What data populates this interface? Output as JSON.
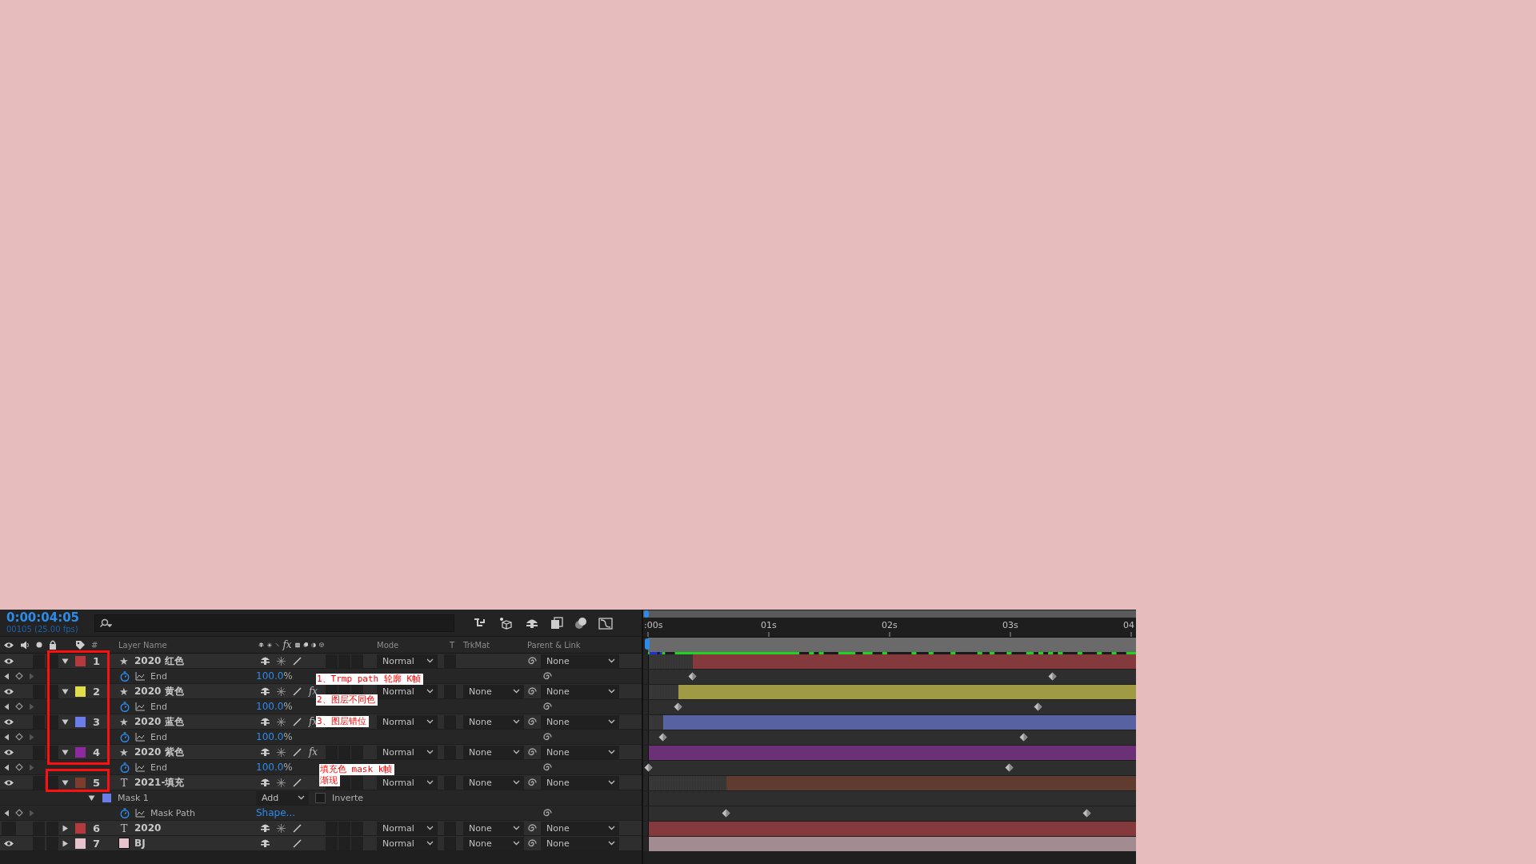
{
  "time": {
    "timecode": "0:00:04:05",
    "frames": "00105 (25.00 fps)"
  },
  "columns": {
    "hash": "#",
    "layer_name": "Layer Name",
    "effects": "fx",
    "mode": "Mode",
    "t": "T",
    "trkmat": "TrkMat",
    "parent": "Parent & Link"
  },
  "ruler": [
    ":00s",
    "01s",
    "02s",
    "03s",
    "04"
  ],
  "rows": [
    {
      "kind": "layer",
      "number": "1",
      "icon": "★",
      "name": "2020 红色",
      "color": "#b53a3e",
      "expanded": true,
      "visible": true,
      "mode": "Normal",
      "parent": "None",
      "level": 0.91
    },
    {
      "kind": "property",
      "name": "End",
      "value": "100.0",
      "unit": "%"
    },
    {
      "kind": "layer",
      "number": "2",
      "icon": "★",
      "name": "2020 黄色",
      "color": "#e3dc4a",
      "expanded": true,
      "visible": true,
      "effects": "fx",
      "mode": "Normal",
      "trkmat": "None",
      "parent": "None",
      "level": 0.94
    },
    {
      "kind": "property",
      "name": "End",
      "value": "100.0",
      "unit": "%"
    },
    {
      "kind": "layer",
      "number": "3",
      "icon": "★",
      "name": "2020 蓝色",
      "color": "#6b7de8",
      "expanded": true,
      "visible": true,
      "effects": "fx",
      "mode": "Normal",
      "trkmat": "None",
      "parent": "None",
      "level": 0.97
    },
    {
      "kind": "property",
      "name": "End",
      "value": "100.0",
      "unit": "%"
    },
    {
      "kind": "layer",
      "number": "4",
      "icon": "★",
      "name": "2020 紫色",
      "color": "#8e2aa0",
      "expanded": true,
      "visible": true,
      "effects": "fx",
      "mode": "Normal",
      "trkmat": "None",
      "parent": "None",
      "level": 1
    },
    {
      "kind": "property",
      "name": "End",
      "value": "100.0",
      "unit": "%"
    },
    {
      "kind": "layer",
      "number": "5",
      "icon": "T",
      "name": "2021-填充",
      "color": "#7a3e2a",
      "expanded": true,
      "visible": true,
      "mode": "Normal",
      "trkmat": "None",
      "parent": "None",
      "level": 0.84
    },
    {
      "kind": "mask",
      "name": "Mask 1",
      "color": "#6b7de8",
      "expanded": true,
      "mode": "Add",
      "checked": false,
      "option": "Inverte"
    },
    {
      "kind": "property",
      "name": "Mask Path",
      "value": "Shape..."
    },
    {
      "kind": "layer",
      "number": "6",
      "icon": "T",
      "name": "2020",
      "color": "#b53a3e",
      "expanded": false,
      "visible": false,
      "mode": "Normal",
      "trkmat": "None",
      "parent": "None",
      "level": 1
    },
    {
      "kind": "layer",
      "number": "7",
      "name": "BJ",
      "color": "#e8c2cc",
      "expanded": false,
      "visible": true,
      "mode": "Normal",
      "trkmat": "None",
      "parent": "None",
      "level": 1
    }
  ],
  "annotations": [
    {
      "text": "1、Trmp path 轮廓 K帧"
    },
    {
      "text": "2、图层不同色"
    },
    {
      "text": "3、图层错位"
    },
    {
      "text": "填充色 mask k帧"
    },
    {
      "text": "渐现"
    }
  ]
}
